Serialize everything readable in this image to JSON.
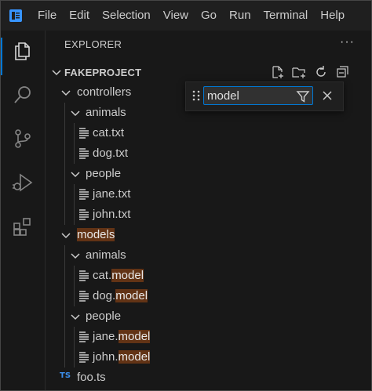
{
  "menu": {
    "items": [
      "File",
      "Edit",
      "Selection",
      "View",
      "Go",
      "Run",
      "Terminal",
      "Help"
    ]
  },
  "activity_bar": {
    "icons": [
      "explorer-icon",
      "search-icon",
      "source-control-icon",
      "run-debug-icon",
      "extensions-icon"
    ],
    "active": "explorer-icon"
  },
  "explorer": {
    "title": "EXPLORER",
    "more": "···",
    "project": "FAKEPROJECT",
    "actions": [
      "new-file-icon",
      "new-folder-icon",
      "refresh-icon",
      "collapse-all-icon"
    ],
    "tree": [
      {
        "label": "controllers",
        "type": "folder",
        "depth": 1,
        "expanded": true
      },
      {
        "label": "animals",
        "type": "folder",
        "depth": 2,
        "expanded": true
      },
      {
        "label": "cat.txt",
        "type": "file",
        "depth": 3
      },
      {
        "label": "dog.txt",
        "type": "file",
        "depth": 3
      },
      {
        "label": "people",
        "type": "folder",
        "depth": 2,
        "expanded": true
      },
      {
        "label": "jane.txt",
        "type": "file",
        "depth": 3
      },
      {
        "label": "john.txt",
        "type": "file",
        "depth": 3
      },
      {
        "label": "models",
        "type": "folder",
        "depth": 1,
        "expanded": true,
        "highlight": "models"
      },
      {
        "label": "animals",
        "type": "folder",
        "depth": 2,
        "expanded": true
      },
      {
        "label": "cat.model",
        "prefix": "cat.",
        "highlight": "model",
        "type": "file",
        "depth": 3
      },
      {
        "label": "dog.model",
        "prefix": "dog.",
        "highlight": "model",
        "type": "file",
        "depth": 3
      },
      {
        "label": "people",
        "type": "folder",
        "depth": 2,
        "expanded": true
      },
      {
        "label": "jane.model",
        "prefix": "jane.",
        "highlight": "model",
        "type": "file",
        "depth": 3
      },
      {
        "label": "john.model",
        "prefix": "john.",
        "highlight": "model",
        "type": "file",
        "depth": 3
      },
      {
        "label": "foo.ts",
        "type": "ts",
        "depth": 1
      }
    ]
  },
  "find": {
    "value": "model",
    "filter_icon": "filter-icon",
    "close_icon": "close-icon"
  },
  "colors": {
    "accent": "#0078d4",
    "match_highlight": "#623315",
    "ts_blue": "#3b8eea",
    "logo_blue": "#3794ff"
  }
}
